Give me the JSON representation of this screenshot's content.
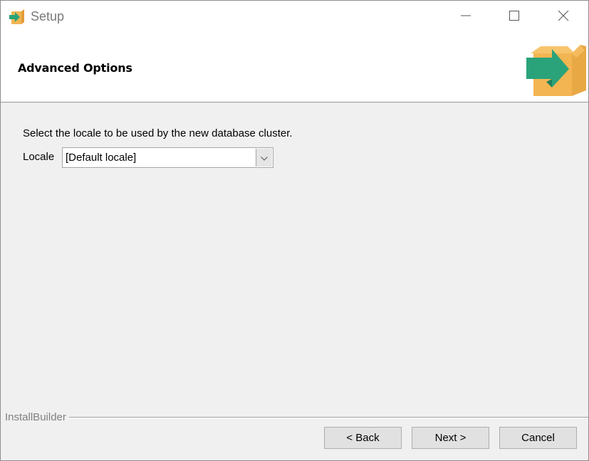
{
  "window": {
    "title": "Setup",
    "icon": "installer-box-arrow-icon",
    "controls": {
      "minimize": "minimize-icon",
      "maximize": "maximize-icon",
      "close": "close-icon"
    }
  },
  "header": {
    "title": "Advanced Options",
    "logo": "installer-box-arrow-icon"
  },
  "main": {
    "description": "Select the locale to be used by the new database cluster.",
    "locale_label": "Locale",
    "locale_select": {
      "value": "[Default locale]",
      "icon": "chevron-down-icon"
    }
  },
  "footer": {
    "brand": "InstallBuilder",
    "buttons": {
      "back": "< Back",
      "next": "Next >",
      "cancel": "Cancel"
    }
  },
  "colors": {
    "box": "#f2b552",
    "box_dark": "#e29d3a",
    "arrow": "#2aa37a"
  }
}
